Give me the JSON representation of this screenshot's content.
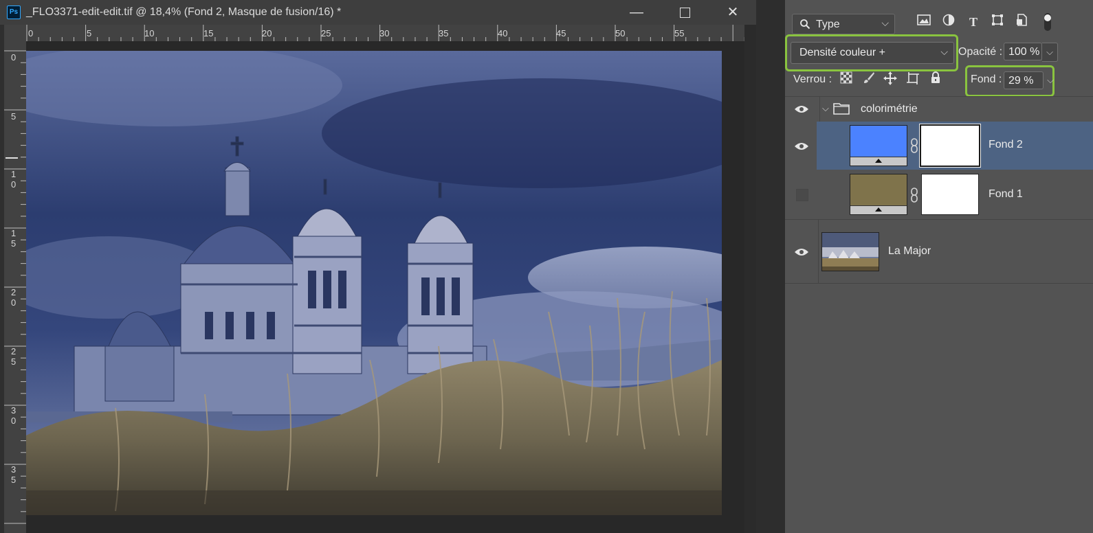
{
  "app": "Ps",
  "document": {
    "title": "_FLO3371-edit-edit.tif @ 18,4% (Fond 2, Masque de fusion/16) *",
    "ruler_h": [
      "0",
      "5",
      "10",
      "15",
      "20",
      "25",
      "30",
      "35",
      "40",
      "45",
      "50",
      "55"
    ],
    "ruler_v": [
      {
        "a": "0",
        "b": ""
      },
      {
        "a": "5",
        "b": ""
      },
      {
        "a": "1",
        "b": "0"
      },
      {
        "a": "1",
        "b": "5"
      },
      {
        "a": "2",
        "b": "0"
      },
      {
        "a": "2",
        "b": "5"
      },
      {
        "a": "3",
        "b": "0"
      },
      {
        "a": "3",
        "b": "5"
      }
    ]
  },
  "layers_panel": {
    "filter": {
      "label": "Type"
    },
    "blend_mode": "Densité couleur +",
    "opacity_label": "Opacité :",
    "opacity_value": "100 %",
    "lock_label": "Verrou :",
    "fill_label": "Fond :",
    "fill_value": "29 %",
    "group": {
      "name": "colorimétrie",
      "visible": true,
      "expanded": true
    },
    "layers": [
      {
        "name": "Fond 2",
        "visible": true,
        "selected": true,
        "color": "#4b82ff"
      },
      {
        "name": "Fond 1",
        "visible": false,
        "selected": false,
        "color": "#7f734b"
      },
      {
        "name": "La Major",
        "visible": true,
        "selected": false
      }
    ]
  },
  "colors": {
    "highlight": "#8ac43f",
    "selected_row": "#4d6383",
    "panel_bg": "#535353"
  }
}
